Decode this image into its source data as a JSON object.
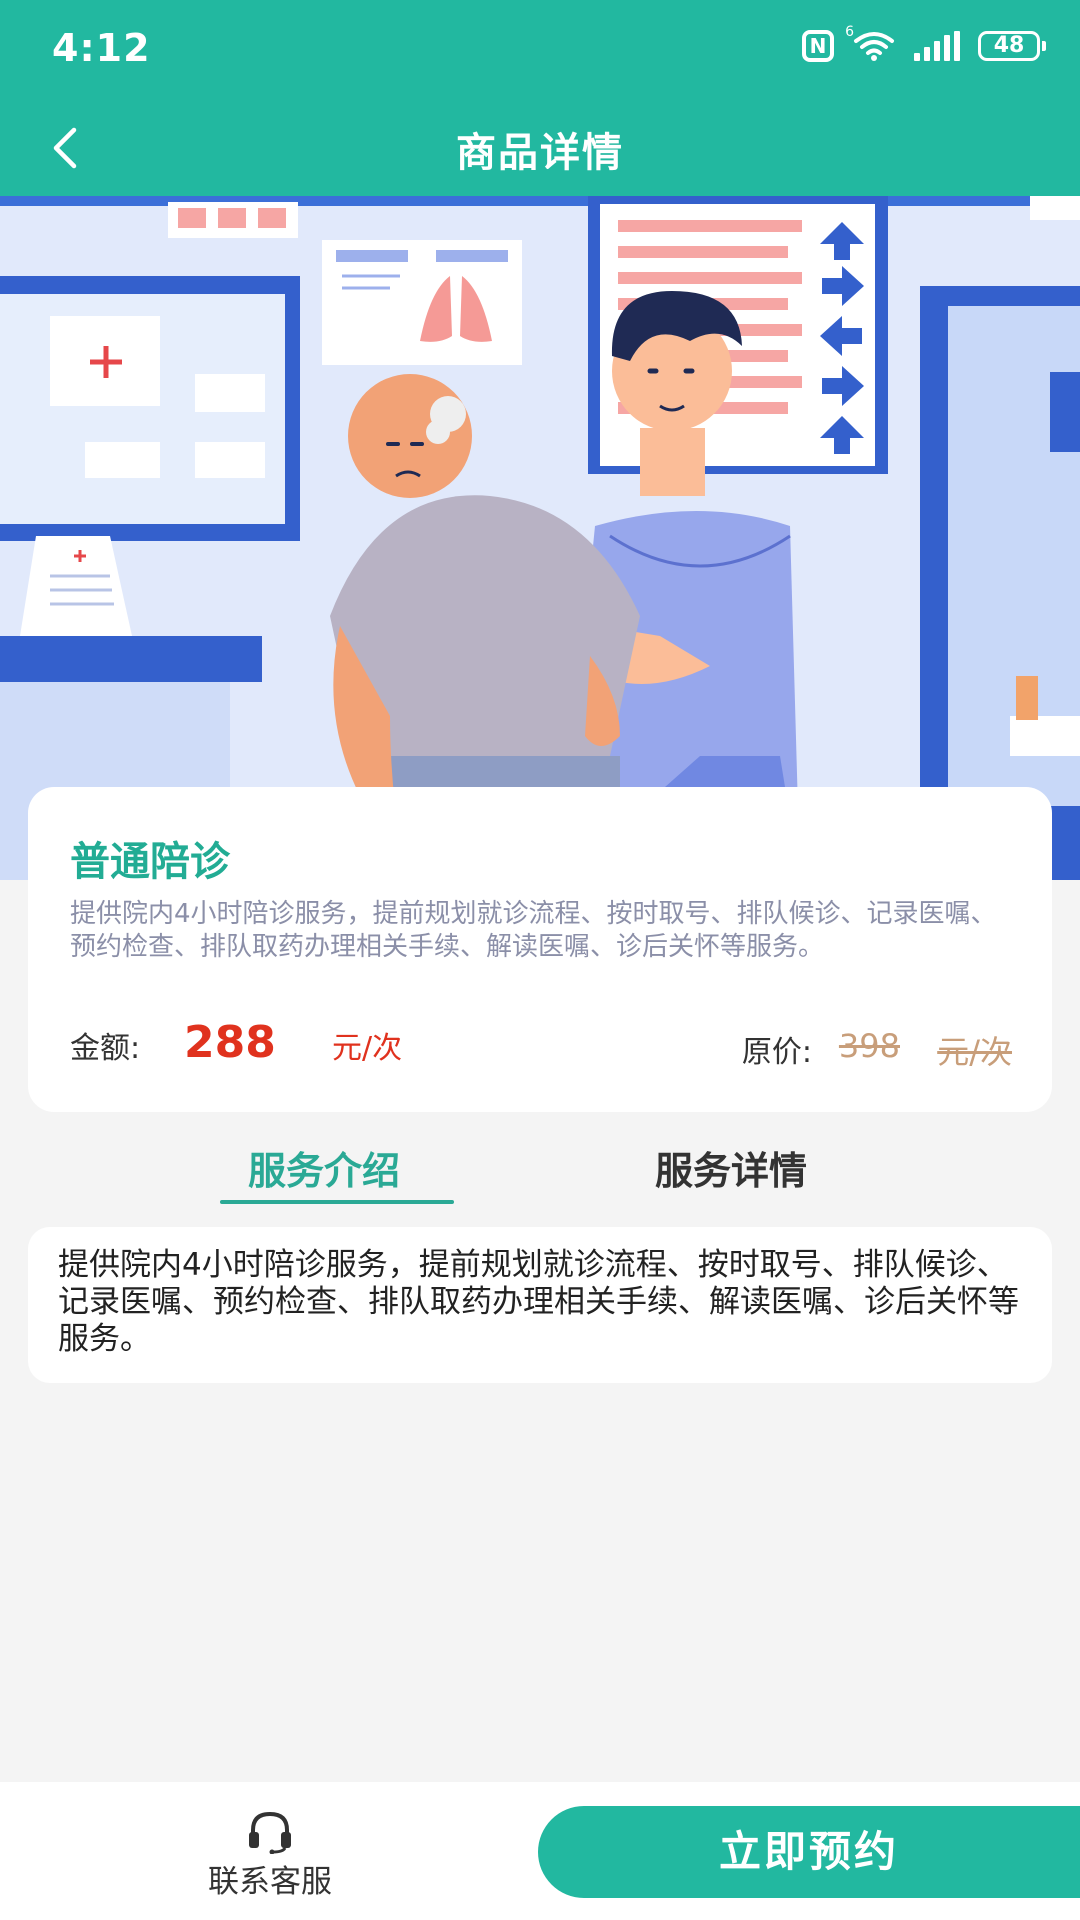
{
  "status_bar": {
    "time": "4:12",
    "nfc": "N",
    "wifi_label": "6",
    "battery": "48"
  },
  "nav": {
    "title": "商品详情"
  },
  "service": {
    "name": "普通陪诊",
    "description": "提供院内4小时陪诊服务，提前规划就诊流程、按时取号、排队候诊、记录医嘱、预约检查、排队取药办理相关手续、解读医嘱、诊后关怀等服务。",
    "price_label": "金额:",
    "price": "288",
    "price_unit": "元/次",
    "original_label": "原价:",
    "original_price": "398",
    "original_unit": "元/次"
  },
  "tabs": [
    {
      "label": "服务介绍",
      "active": true
    },
    {
      "label": "服务详情",
      "active": false
    }
  ],
  "intro": {
    "text": "提供院内4小时陪诊服务，提前规划就诊流程、按时取号、排队候诊、记录医嘱、预约检查、排队取药办理相关手续、解读医嘱、诊后关怀等服务。"
  },
  "bottom": {
    "customer_service": "联系客服",
    "book": "立即预约"
  },
  "colors": {
    "brand": "#22b8a0",
    "price": "#e0321e",
    "original_price": "#c89e7a"
  }
}
